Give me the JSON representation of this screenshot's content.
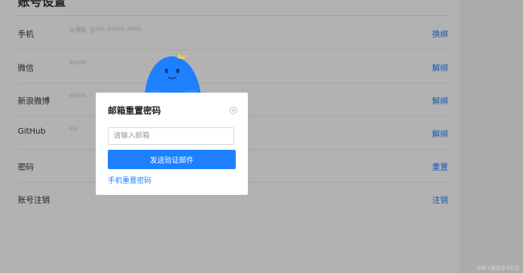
{
  "settings": {
    "title": "账号设置",
    "rows": [
      {
        "label": "手机",
        "value": "+86 1** **** ***",
        "action": "换绑"
      },
      {
        "label": "微信",
        "value": "****",
        "action": "解绑"
      },
      {
        "label": "新浪微博",
        "value": "****",
        "action": "解绑"
      },
      {
        "label": "GitHub",
        "value": "**",
        "action": "解绑"
      },
      {
        "label": "密码",
        "value": "",
        "action": "重置"
      },
      {
        "label": "账号注销",
        "value": "",
        "action": "注销"
      }
    ]
  },
  "modal": {
    "title": "邮箱重置密码",
    "close_icon": "close-circle-icon",
    "email_placeholder": "请输入邮箱",
    "email_value": "",
    "send_button": "发送验证邮件",
    "phone_reset_link": "手机重置密码",
    "mascot_icon": "blue-mascot-icon"
  },
  "watermark": "@稀土掘金技术社区",
  "colors": {
    "accent": "#1e80ff",
    "overlay": "rgba(0,0,0,0.3)",
    "mascot_body": "#1e80ff",
    "mascot_tuft": "#f7d13d"
  }
}
